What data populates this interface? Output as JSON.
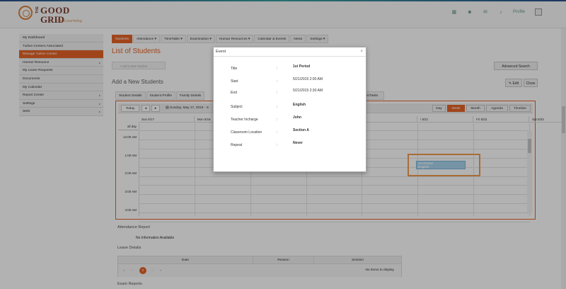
{
  "logo": {
    "the": "THE",
    "line1": "GOOD",
    "line2": "GRID",
    "tagline": "for Learning"
  },
  "header": {
    "profile_label": "Profile",
    "icons": [
      "grid-icon",
      "users-icon",
      "mail-icon",
      "bell-icon"
    ]
  },
  "sidebar": {
    "items": [
      {
        "label": "My Dashboard",
        "arrow": ""
      },
      {
        "label": "Tuition Centers Associated",
        "arrow": ""
      },
      {
        "label": "Manage Tuition Center",
        "arrow": "",
        "active": true
      },
      {
        "label": "Human Resource",
        "arrow": "▸"
      },
      {
        "label": "My Leave Requests",
        "arrow": ""
      },
      {
        "label": "Documents",
        "arrow": ""
      },
      {
        "label": "My Calendar",
        "arrow": ""
      },
      {
        "label": "Report Center",
        "arrow": "▸"
      },
      {
        "label": "Settings",
        "arrow": "▸"
      },
      {
        "label": "SMS",
        "arrow": "▸"
      }
    ]
  },
  "nav": {
    "items": [
      "Students",
      "Attendance ▾",
      "TimeTable ▾",
      "Examination ▾",
      "Human Resources ▾",
      "Calendar & Events",
      "News",
      "Settings ▾"
    ]
  },
  "page": {
    "title": "List of Students",
    "add_button": "+ Add a New Student",
    "advanced_search": "Advanced Search",
    "section_title": "Add a New Students",
    "edit": "✎ Edit",
    "close": "Close"
  },
  "student_tabs": [
    "Student Details",
    "Student Profile",
    "Family Details"
  ],
  "student_tab_right": "ues/Tasks",
  "calendar": {
    "today": "Today",
    "prev": "◂",
    "next": "▸",
    "date_range": "Sunday, May 17, 2015 - S",
    "views": [
      "Day",
      "Week",
      "Month",
      "Agenda",
      "Timeline"
    ],
    "days": [
      "Sun 5/17",
      "Mon 5/18",
      "",
      "",
      "",
      "i 5/21",
      "Fri 5/22",
      "Sat 5/23"
    ],
    "all_day": "all day",
    "times": [
      "12:00 AM",
      "1:00 AM",
      "2:00 AM",
      "3:00 AM",
      "4:00 AM"
    ],
    "event": {
      "line1": "1st Period",
      "line2": "English"
    }
  },
  "attendance": {
    "title": "Attendance Report",
    "empty": "No Information Available"
  },
  "leave": {
    "title": "Leave Details",
    "columns": [
      "Date",
      "Reason",
      "Session"
    ],
    "pager": [
      "«",
      "‹",
      "0",
      "›",
      "»"
    ],
    "empty": "No items to display"
  },
  "exam": {
    "title": "Exam Reports"
  },
  "modal": {
    "title": "Event",
    "close": "×",
    "fields": [
      {
        "label": "Title",
        "value": "1st Period",
        "bold": true
      },
      {
        "label": "Start",
        "value": "5/21/2015 2:00 AM",
        "bold": false
      },
      {
        "label": "End",
        "value": "5/21/2015 2:30 AM",
        "bold": false
      },
      {
        "label": "Subject",
        "value": "English",
        "bold": true
      },
      {
        "label": "Teacher Incharge",
        "value": "John",
        "bold": true
      },
      {
        "label": "Classroom Location",
        "value": "Section A",
        "bold": true
      },
      {
        "label": "Repeat",
        "value": "Never",
        "bold": true
      }
    ]
  }
}
